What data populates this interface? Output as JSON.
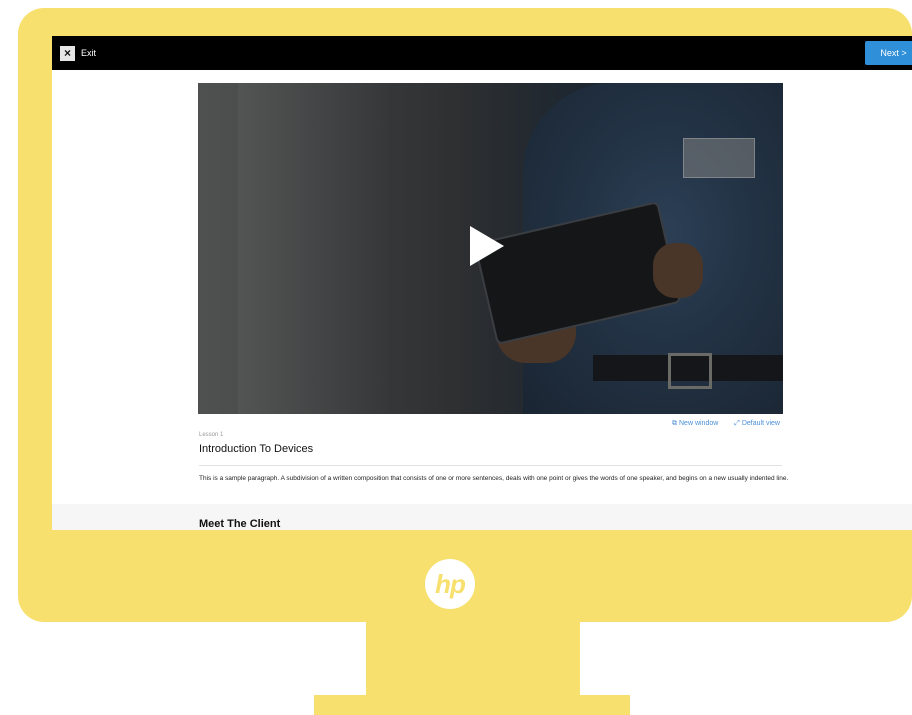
{
  "topbar": {
    "exit_label": "Exit",
    "next_label": "Next  >"
  },
  "video": {
    "new_window_label": "New window",
    "default_view_label": "Default view"
  },
  "lesson": {
    "label": "Lesson 1",
    "title": "Introduction To Devices",
    "paragraph": "This is a sample paragraph. A subdivision of a written composition that consists of one or more sentences, deals with one point or gives the words of one speaker, and begins on a new usually indented line."
  },
  "next_section": {
    "title": "Meet The Client"
  },
  "brand": {
    "logo_text": "hp",
    "frame_color": "#f8e06e",
    "accent_color": "#2f8fd8"
  }
}
